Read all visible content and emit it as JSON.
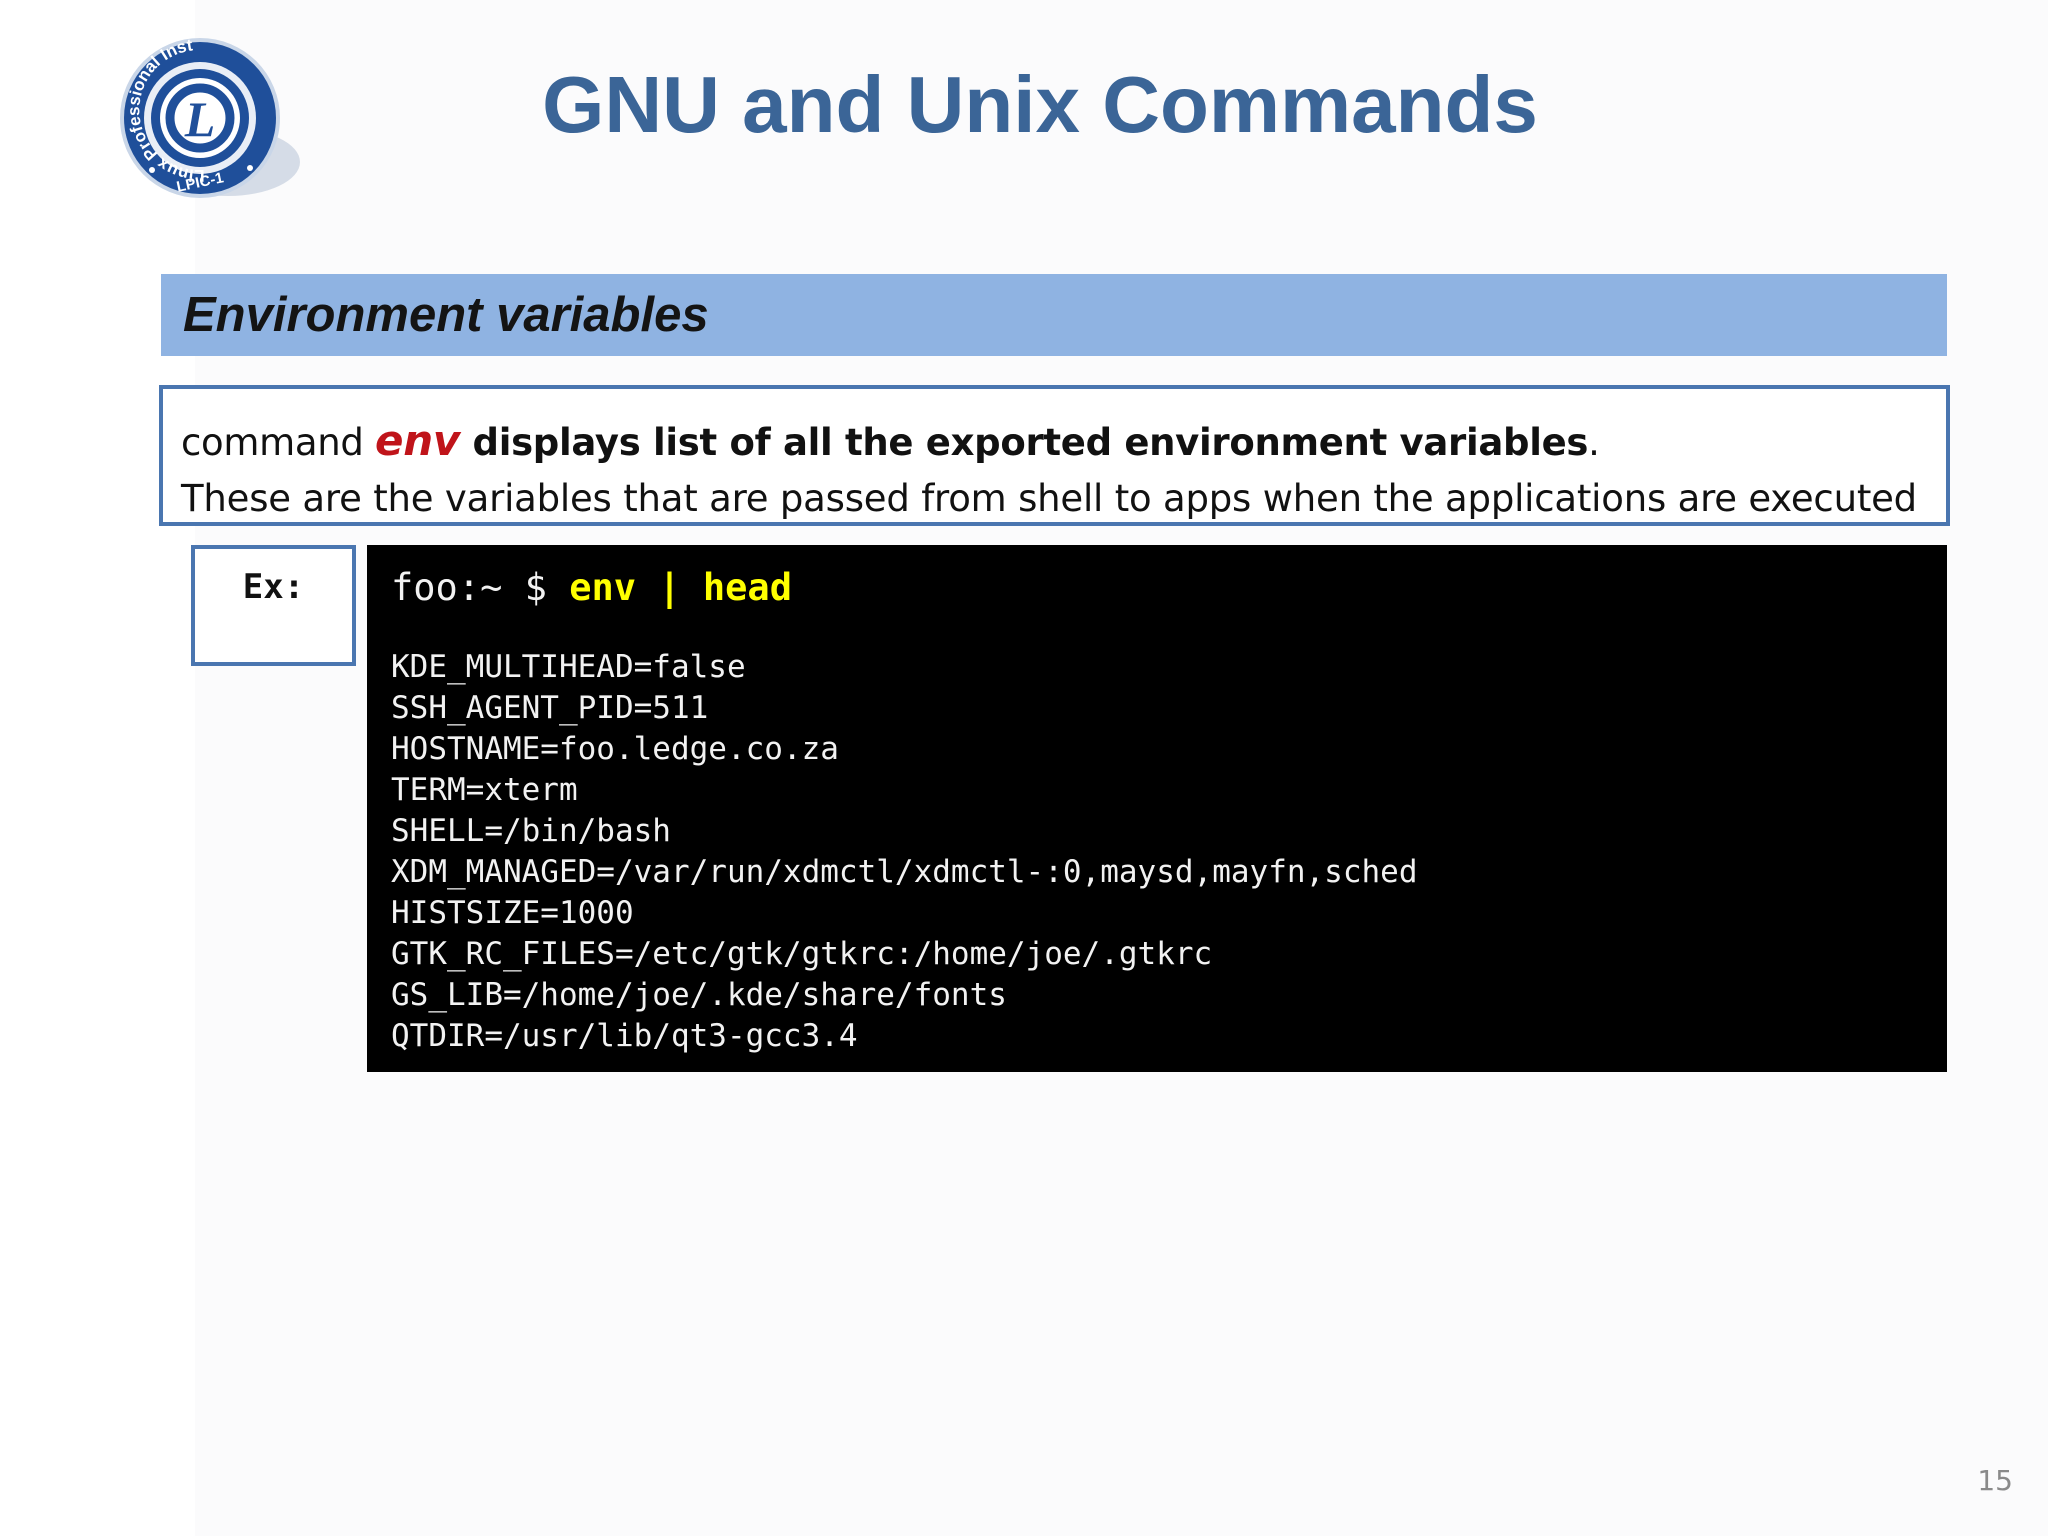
{
  "header": {
    "title": "GNU and Unix Commands",
    "logo": {
      "icon": "lpi-seal-logo",
      "text_top": "Linux Professional Institute",
      "text_bottom": "LPIC-1",
      "letter": "L"
    }
  },
  "section": {
    "heading": "Environment variables"
  },
  "description": {
    "line1_prefix": "command ",
    "line1_keyword": "env",
    "line1_bold": " displays list of all the exported environment variables",
    "line1_suffix": ".",
    "line2": "These are the variables that are passed from shell to apps when the applications are executed"
  },
  "example": {
    "label": "Ex:",
    "prompt": "foo:~ $ ",
    "command": "env | head",
    "output": [
      "KDE_MULTIHEAD=false",
      "SSH_AGENT_PID=511",
      "HOSTNAME=foo.ledge.co.za",
      "TERM=xterm",
      "SHELL=/bin/bash",
      "XDM_MANAGED=/var/run/xdmctl/xdmctl-:0,maysd,mayfn,sched",
      "HISTSIZE=1000",
      "GTK_RC_FILES=/etc/gtk/gtkrc:/home/joe/.gtkrc",
      "GS_LIB=/home/joe/.kde/share/fonts",
      "QTDIR=/usr/lib/qt3-gcc3.4"
    ]
  },
  "page_number": "15",
  "colors": {
    "title": "#3b6597",
    "section_bar": "#8fb3e2",
    "box_border": "#4a76b0",
    "keyword": "#c0141a",
    "terminal_bg": "#000000",
    "terminal_command": "#ffff00"
  }
}
